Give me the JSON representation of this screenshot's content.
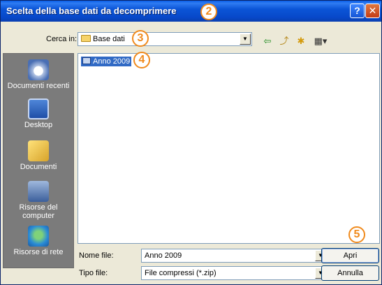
{
  "window": {
    "title": "Scelta della base dati da decomprimere"
  },
  "titlebar": {
    "help_label": "?",
    "close_label": "✕"
  },
  "lookin": {
    "label": "Cerca in:",
    "value": "Base dati"
  },
  "toolbar": {
    "back_icon": "⇦",
    "up_icon": "⤴",
    "new_folder_icon": "✱",
    "view_icon": "▦▾"
  },
  "places": [
    {
      "label": "Documenti recenti",
      "icon": "recent-documents-icon"
    },
    {
      "label": "Desktop",
      "icon": "desktop-icon"
    },
    {
      "label": "Documenti",
      "icon": "documents-icon"
    },
    {
      "label": "Risorse del computer",
      "icon": "my-computer-icon"
    },
    {
      "label": "Risorse di rete",
      "icon": "network-icon"
    }
  ],
  "files": [
    {
      "name": "Anno 2009",
      "selected": true
    }
  ],
  "filename": {
    "label": "Nome file:",
    "value": "Anno 2009"
  },
  "filetype": {
    "label": "Tipo file:",
    "value": "File compressi (*.zip)"
  },
  "buttons": {
    "open": "Apri",
    "cancel": "Annulla"
  },
  "badges": [
    "2",
    "3",
    "4",
    "5"
  ],
  "colors": {
    "accent": "#316ac5",
    "badge": "#f08a1c",
    "titlebar": "#0b55d7"
  }
}
